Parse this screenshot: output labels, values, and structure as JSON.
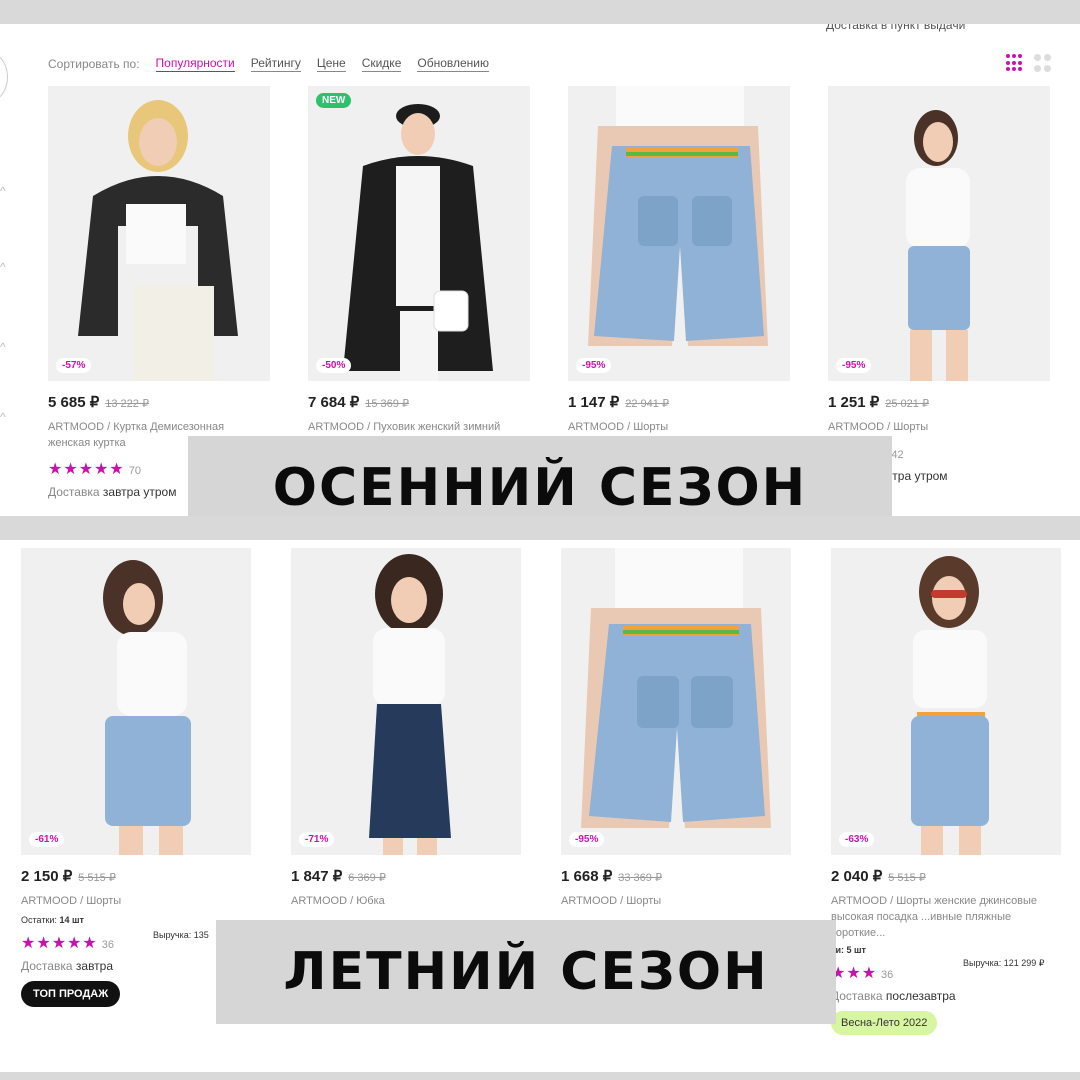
{
  "top": {
    "topline": "Доставка в пункт выдачи",
    "sort_label": "Сортировать по:",
    "sort_options": [
      "Популярности",
      "Рейтингу",
      "Цене",
      "Скидке",
      "Обновлению"
    ],
    "products": [
      {
        "price": "5 685 ₽",
        "old": "13 222 ₽",
        "discount": "-57%",
        "name": "ARTMOOD / Куртка Демисезонная женская куртка",
        "stars": "★★★★★",
        "count": "70",
        "delivery_label": "Доставка",
        "delivery_value": "завтра утром"
      },
      {
        "price": "7 684 ₽",
        "old": "15 369 ₽",
        "discount": "-50%",
        "new": "NEW",
        "name": "ARTMOOD / Пуховик женский зимний"
      },
      {
        "price": "1 147 ₽",
        "old": "22 941 ₽",
        "discount": "-95%",
        "name": "ARTMOOD / Шорты"
      },
      {
        "price": "1 251 ₽",
        "old": "25 021 ₽",
        "discount": "-95%",
        "name": "ARTMOOD / Шорты",
        "stars": "★",
        "count": "42",
        "delivery_value": "завтра утром"
      }
    ],
    "label": "ОСЕННИЙ СЕЗОН"
  },
  "bottom": {
    "products": [
      {
        "price": "2 150 ₽",
        "old": "5 515 ₽",
        "discount": "-61%",
        "name": "ARTMOOD / Шорты",
        "stock_label": "Остатки:",
        "stock_value": "14 шт",
        "revenue": "Выручка: 135",
        "stars": "★★★★★",
        "count": "36",
        "delivery_label": "Доставка",
        "delivery_value": "завтра",
        "badge": "ТОП ПРОДАЖ"
      },
      {
        "price": "1 847 ₽",
        "old": "6 369 ₽",
        "discount": "-71%",
        "name": "ARTMOOD / Юбка"
      },
      {
        "price": "1 668 ₽",
        "old": "33 369 ₽",
        "discount": "-95%",
        "name": "ARTMOOD / Шорты"
      },
      {
        "price": "2 040 ₽",
        "old": "5 515 ₽",
        "discount": "-63%",
        "name": "ARTMOOD / Шорты женские джинсовые высокая посадка ...ивные пляжные короткие...",
        "stock_value": "ки: 5 шт",
        "revenue": "Выручка: 121 299 ₽",
        "stars": "★★★",
        "count": "36",
        "delivery_label": "Доставка",
        "delivery_value": "послезавтра",
        "badge": "Весна-Лето 2022"
      }
    ],
    "label": "ЛЕТНИЙ СЕЗОН"
  },
  "colors": {
    "accent": "#cb11ab",
    "new": "#2ec06b",
    "season": "#d8f5a2",
    "label_bg": "#d6d6d6"
  }
}
